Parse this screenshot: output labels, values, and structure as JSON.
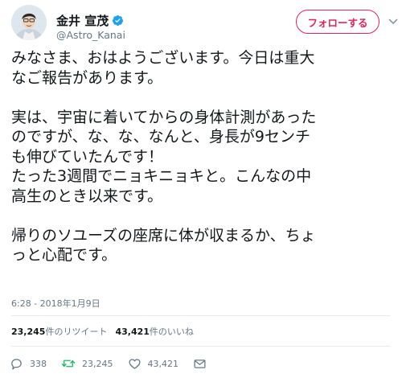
{
  "user": {
    "display_name": "金井 宣茂",
    "handle": "@Astro_Kanai",
    "verified": true
  },
  "follow_button": {
    "label": "フォローする",
    "color": "#e0245e"
  },
  "tweet": {
    "lines": [
      "みなさま、おはようございます。今日は重大",
      "なご報告があります。",
      "",
      "実は、宇宙に着いてからの身体計測があった",
      "のですが、な、な、なんと、身長が9センチ",
      "も伸びていたんです！",
      "たった3週間でニョキニョキと。こんなの中",
      "高生のとき以来です。",
      "",
      "帰りのソユーズの座席に体が収まるか、ちょ",
      "っと心配です。"
    ],
    "timestamp": "6:28 - 2018年1月9日"
  },
  "stats": {
    "retweets_count": "23,245",
    "retweets_label": "件のリツイート",
    "likes_count": "43,421",
    "likes_label": "件のいいね"
  },
  "actions": {
    "reply": {
      "icon": "reply-icon",
      "count": "338"
    },
    "retweet": {
      "icon": "retweet-icon",
      "count": "23,245"
    },
    "like": {
      "icon": "heart-icon",
      "count": "43,421"
    },
    "dm": {
      "icon": "envelope-icon"
    }
  },
  "colors": {
    "verified": "#1da1f2",
    "retweet_action": "#17bf63",
    "secondary_text": "#657786"
  }
}
